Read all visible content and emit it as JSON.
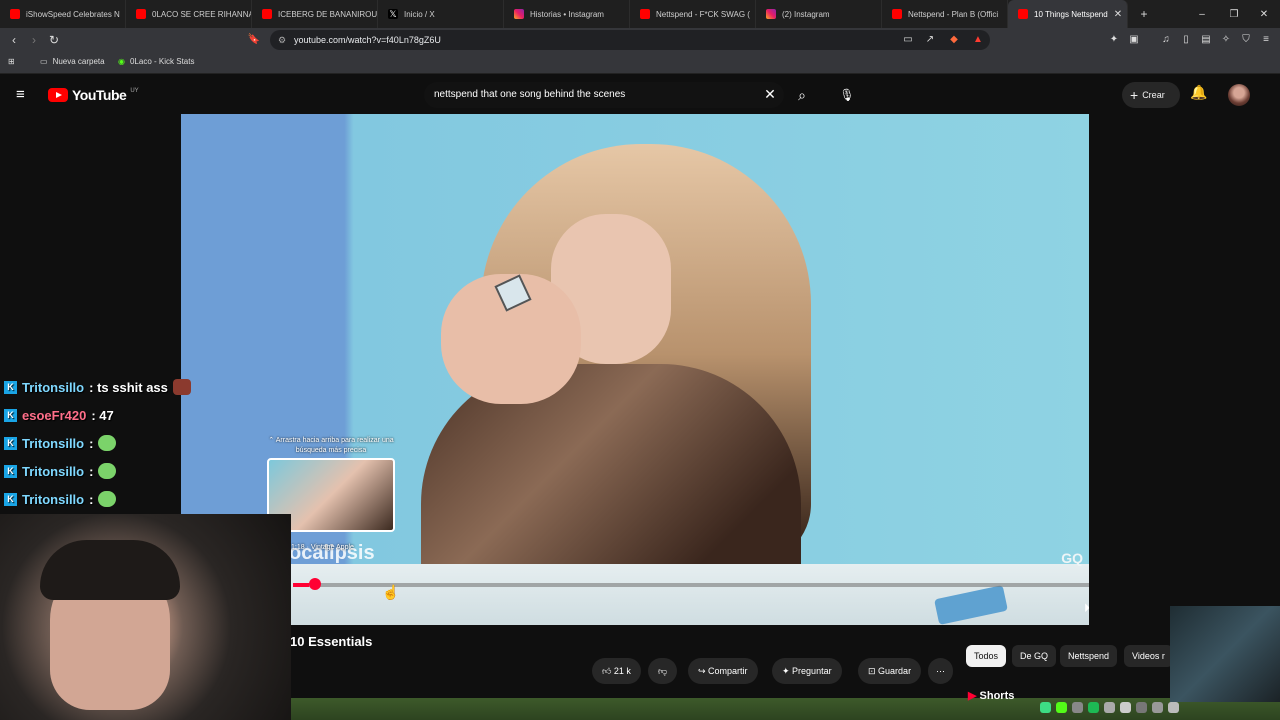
{
  "browser": {
    "tabs": [
      {
        "label": "iShowSpeed Celebrates N",
        "icon": "youtube-icon"
      },
      {
        "label": "0LACO SE CREE RIHANNA",
        "icon": "youtube-icon"
      },
      {
        "label": "ICEBERG DE BANANIROU",
        "icon": "youtube-icon"
      },
      {
        "label": "Inicio / X",
        "icon": "x-icon"
      },
      {
        "label": "Historias • Instagram",
        "icon": "instagram-icon"
      },
      {
        "label": "Nettspend - F*CK SWAG (",
        "icon": "youtube-icon"
      },
      {
        "label": "(2) Instagram",
        "icon": "instagram-icon"
      },
      {
        "label": "Nettspend - Plan B (Offici",
        "icon": "youtube-icon"
      },
      {
        "label": "10 Things Nettspend",
        "icon": "youtube-icon",
        "active": true
      }
    ],
    "new_tab": "+",
    "window": {
      "minimize": "–",
      "maximize": "❐",
      "close": "✕"
    },
    "url": "youtube.com/watch?v=f40Ln78gZ6U",
    "bookmarks": [
      {
        "label": "Nueva carpeta",
        "icon": "folder-icon"
      },
      {
        "label": "0Laco - Kick Stats",
        "icon": "kick-icon"
      }
    ]
  },
  "youtube": {
    "logo": "YouTube",
    "country": "UY",
    "search_value": "nettspend that one song behind the scenes",
    "create_label": "Crear"
  },
  "player": {
    "hint": "⌃ Arrastra hacia arriba para realizar una búsqueda más precisa",
    "thumb_label": "1:18 · Vintage Apple",
    "chapter": "ocalipsis",
    "watermark": "GQ",
    "progress": 0.02
  },
  "video": {
    "title": "10 Essentials",
    "likes": "21 k",
    "share": "Compartir",
    "ask": "Preguntar",
    "save": "Guardar"
  },
  "chips": [
    "Todos",
    "De GQ",
    "Nettspend",
    "Videos r"
  ],
  "shorts": "Shorts",
  "chat": [
    {
      "user": "Tritonsillo",
      "msg": ": ts sshit ass",
      "color": "#7fd8ff"
    },
    {
      "user": "esoeFr420",
      "msg": ": 47",
      "color": "#ff6f8a"
    },
    {
      "user": "Tritonsillo",
      "msg": ":",
      "color": "#7fd8ff"
    },
    {
      "user": "Tritonsillo",
      "msg": ":",
      "color": "#7fd8ff"
    },
    {
      "user": "Tritonsillo",
      "msg": ":",
      "color": "#7fd8ff"
    }
  ]
}
